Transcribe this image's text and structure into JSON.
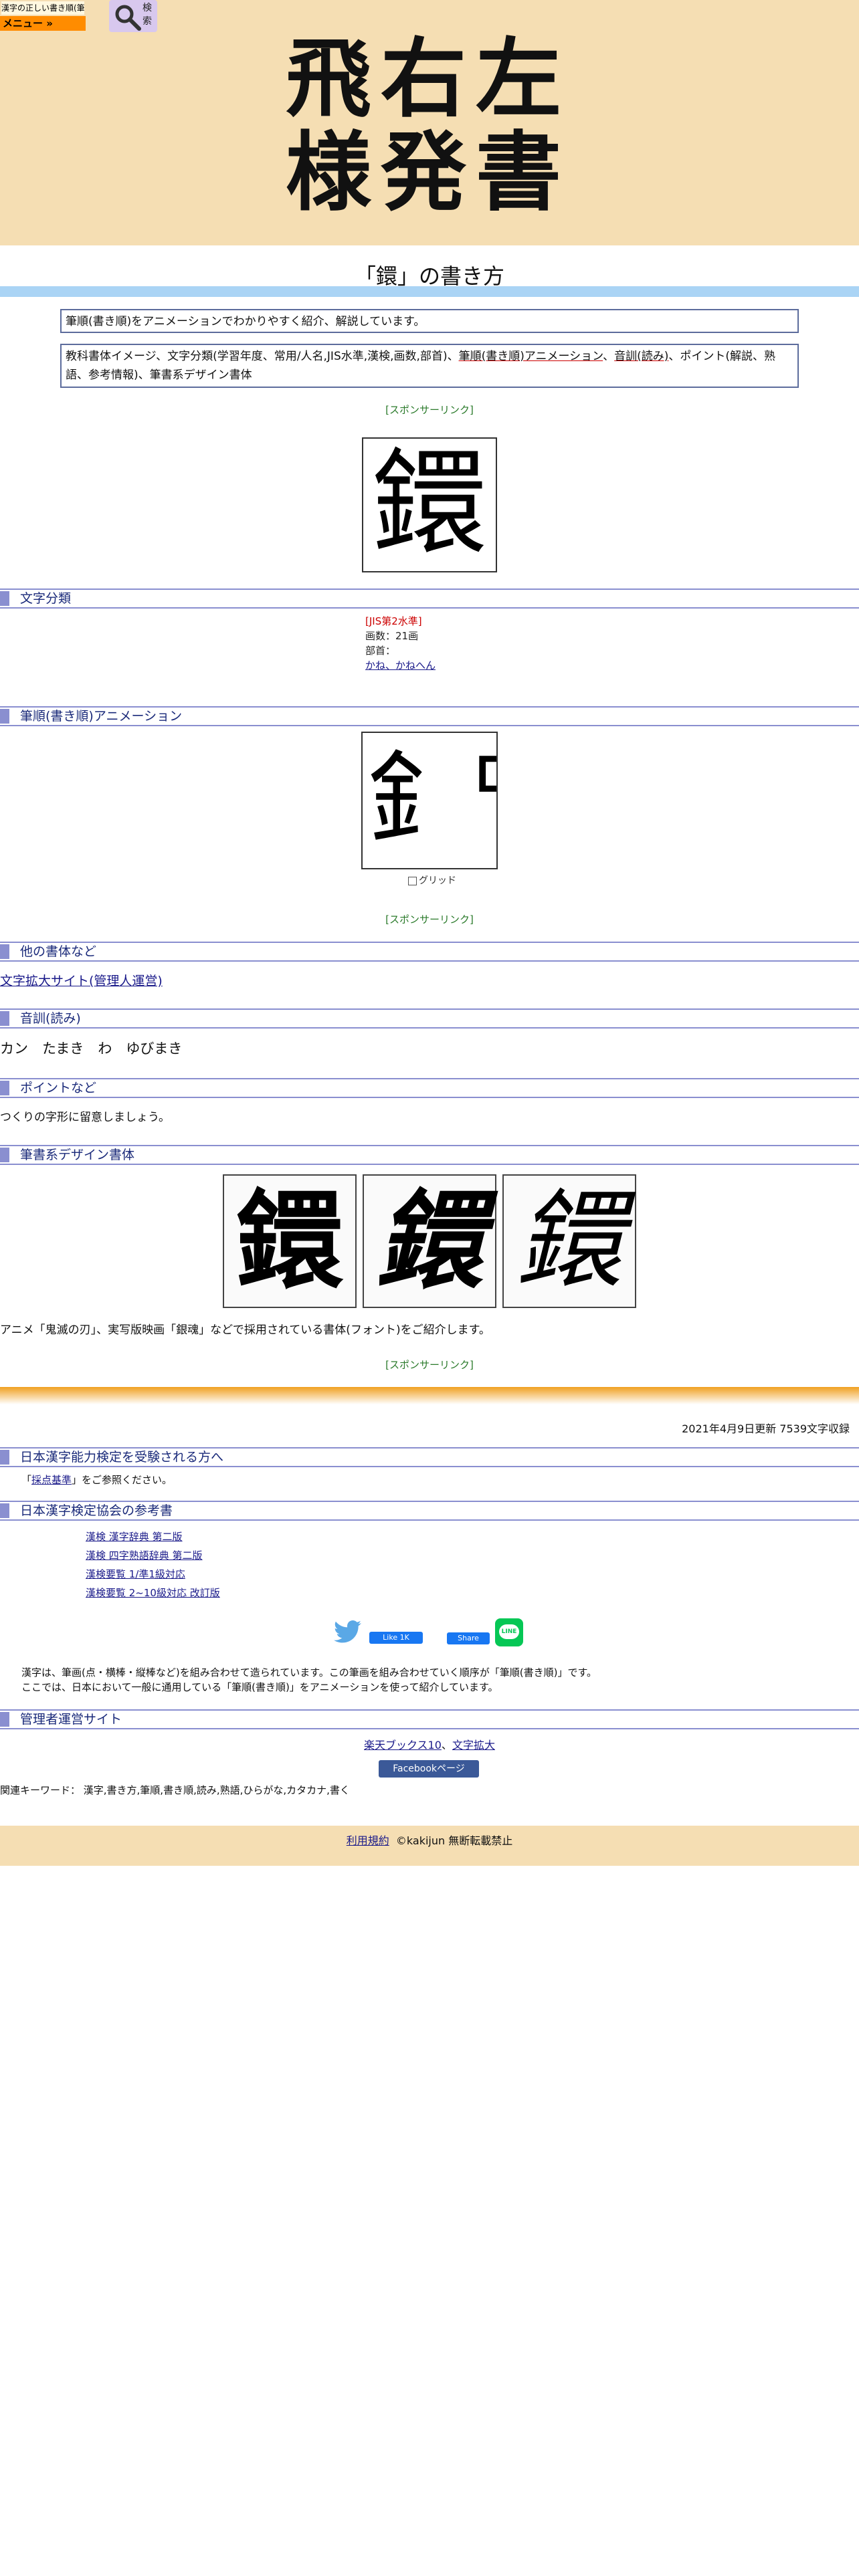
{
  "header": {
    "logo_text": "漢字の正しい書き順(筆順)",
    "menu_label": "メニュー »",
    "search_label": "検索",
    "site_title_line1": "飛右左",
    "site_title_line2": "様発書"
  },
  "page": {
    "title": "「鐶」の書き方",
    "intro": "筆順(書き順)をアニメーションでわかりやすく紹介、解説しています。",
    "contents_prefix": "教科書体イメージ、文字分類(学習年度、常用/人名,JIS水準,漢検,画数,部首)、",
    "contents_link1": "筆順(書き順)アニメーション",
    "contents_sep": "、",
    "contents_link2": "音訓(読み)",
    "contents_suffix": "、ポイント(解説、熟語、参考情報)、筆書系デザイン書体",
    "sponsor": "[スポンサーリンク]",
    "kanji": "鐶",
    "kanji_partial": "釒罒"
  },
  "sections": {
    "classification": "文字分類",
    "animation": "筆順(書き順)アニメーション",
    "other_fonts": "他の書体など",
    "reading": "音訓(読み)",
    "points": "ポイントなど",
    "design_fonts": "筆書系デザイン書体",
    "kanken": "日本漢字能力検定を受験される方へ",
    "association": "日本漢字検定協会の参考書",
    "manager": "管理者運営サイト"
  },
  "classification": {
    "jis": "[JIS第2水準]",
    "strokes": "画数：21画",
    "radical_label": "部首：",
    "radical": "かね、かねへん"
  },
  "animation": {
    "grid_label": "グリッド"
  },
  "other_fonts": {
    "link": "文字拡大サイト(管理人運営)"
  },
  "reading": {
    "text": "カン　たまき　わ　ゆびまき"
  },
  "points": {
    "text": "つくりの字形に留意しましょう。"
  },
  "design": {
    "note": "アニメ「鬼滅の刃」、実写版映画「銀魂」などで採用されている書体(フォント)をご紹介します。"
  },
  "update": "2021年4月9日更新 7539文字収録",
  "kanken": {
    "prefix": "「",
    "link": "採点基準",
    "suffix": "」をご参照ください。"
  },
  "refs": [
    "漢検 漢字辞典 第二版",
    "漢検 四字熟語辞典 第二版",
    "漢検要覧 1/準1級対応",
    "漢検要覧 2~10級対応 改訂版"
  ],
  "social": {
    "like": "Like 1K",
    "share": "Share",
    "line": "LINE"
  },
  "explain": {
    "line1": "漢字は、筆画(点・横棒・縦棒など)を組み合わせて造られています。この筆画を組み合わせていく順序が「筆順(書き順)」です。",
    "line2": "ここでは、日本において一般に通用している「筆順(書き順)」をアニメーションを使って紹介しています。"
  },
  "manager": {
    "link1": "楽天ブックス10",
    "sep": "、",
    "link2": "文字拡大",
    "fb_page": "Facebookページ"
  },
  "keywords": "関連キーワード： 漢字,書き方,筆順,書き順,読み,熟語,ひらがな,カタカナ,書く",
  "footer": {
    "terms": "利用規約",
    "copyright": "©kakijun 無断転載禁止"
  }
}
